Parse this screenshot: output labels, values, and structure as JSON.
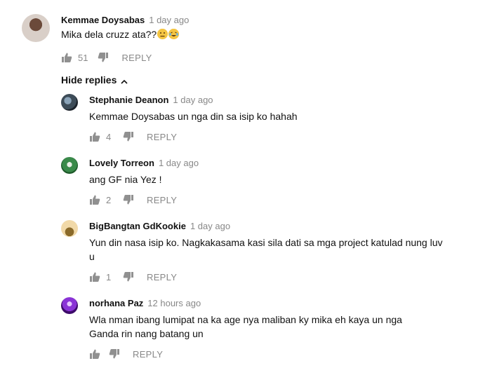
{
  "comments": [
    {
      "author": "Kemmae Doysabas",
      "time": "1 day ago",
      "text": "Mika dela cruzz ata??",
      "emojis": [
        "neutral-face",
        "tears-of-joy-face"
      ],
      "likes": "51",
      "reply_label": "REPLY"
    }
  ],
  "hide_replies_label": "Hide replies",
  "replies": [
    {
      "author": "Stephanie Deanon",
      "time": "1 day ago",
      "text": "Kemmae Doysabas un nga din sa isip ko hahah",
      "likes": "4",
      "reply_label": "REPLY"
    },
    {
      "author": "Lovely Torreon",
      "time": "1 day ago",
      "text": "ang GF nia Yez !",
      "likes": "2",
      "reply_label": "REPLY"
    },
    {
      "author": "BigBangtan GdKookie",
      "time": "1 day ago",
      "text_line1": "Yun din nasa isip ko. Nagkakasama kasi sila dati sa mga project katulad nung luv",
      "text_line2": "u",
      "likes": "1",
      "reply_label": "REPLY"
    },
    {
      "author": "norhana Paz",
      "time": "12 hours ago",
      "text_line1": "Wla nman ibang lumipat na ka age nya maliban ky mika eh kaya un nga",
      "text_line2": "Ganda rin nang batang un",
      "likes": "",
      "reply_label": "REPLY"
    }
  ],
  "icons": {
    "like": "thumbs-up-icon",
    "dislike": "thumbs-down-icon",
    "chevron": "chevron-up-icon"
  },
  "colors": {
    "text": "#111111",
    "meta": "#888888",
    "icon": "#909090"
  }
}
